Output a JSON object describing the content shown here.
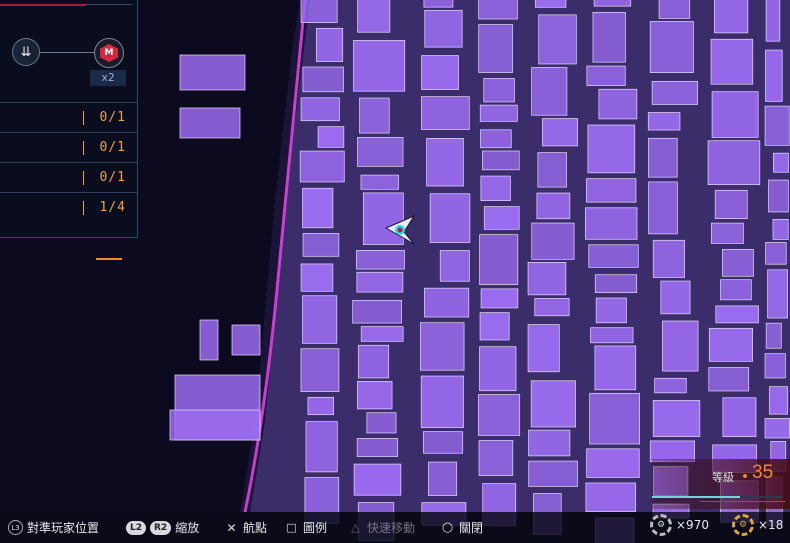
{
  "route": {
    "start_icon": "player-route-icon",
    "end_icon": "boss-hex-icon",
    "end_glyph": "M",
    "multiplier": "x2"
  },
  "objectives": [
    {
      "progress": "0/1"
    },
    {
      "progress": "0/1"
    },
    {
      "progress": "0/1"
    },
    {
      "progress": "1/4"
    }
  ],
  "controls": {
    "recenter_key": "L3",
    "recenter_label": "對準玩家位置",
    "zoom_key1": "L2",
    "zoom_key2": "R2",
    "zoom_label": "縮放",
    "waypoint_key": "✕",
    "waypoint_label": "航點",
    "legend_key": "□",
    "legend_label": "圖例",
    "fasttravel_key": "△",
    "fasttravel_label": "快速移動",
    "close_key": "○",
    "close_label": "關閉"
  },
  "player": {
    "level_label": "等級",
    "level_value": "35",
    "xp_progress": 0.68
  },
  "currencies": {
    "gear_count": "×970",
    "gold_gear_count": "×18"
  },
  "colors": {
    "building": "#9b6cf0",
    "edge": "#e6d8ff",
    "river": "#e040e0",
    "accent": "#f08a30",
    "ground": "#3a2d6a"
  }
}
